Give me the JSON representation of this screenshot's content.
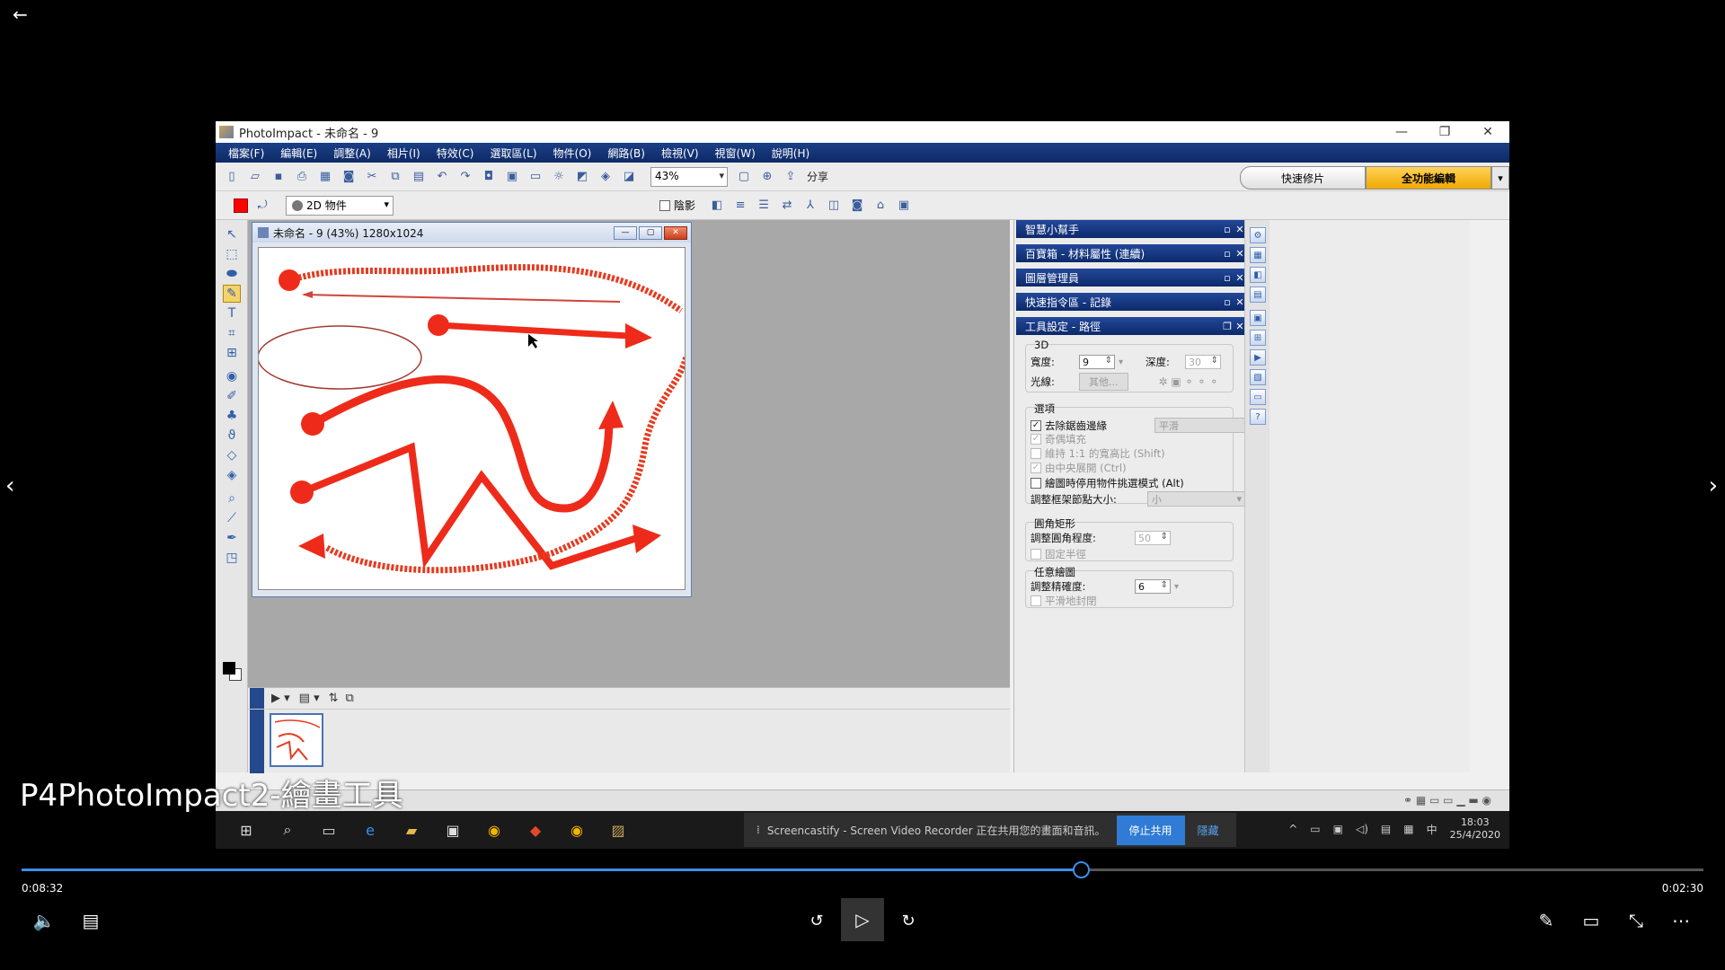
{
  "app": {
    "title": "PhotoImpact - 未命名 - 9",
    "menu": [
      "檔案(F)",
      "編輯(E)",
      "調整(A)",
      "相片(I)",
      "特效(C)",
      "選取區(L)",
      "物件(O)",
      "網路(B)",
      "檢視(V)",
      "視窗(W)",
      "說明(H)"
    ],
    "zoom": "43%",
    "share_label": "分享",
    "mode_quick": "快速修片",
    "mode_full": "全功能編輯",
    "object_type": "2D 物件",
    "shadow_label": "陰影",
    "doc_title": "未命名 - 9 (43%) 1280x1024",
    "panels": [
      "智慧小幫手",
      "百寶箱 - 材料屬性 (連續)",
      "圖層管理員",
      "快速指令區 - 記錄",
      "工具設定 - 路徑"
    ],
    "tool_settings": {
      "group_3d": "3D",
      "width_label": "寬度:",
      "width_value": "9",
      "depth_label": "深度:",
      "depth_value": "30",
      "light_label": "光線:",
      "other_label": "其他...",
      "group_options": "選項",
      "antialias_label": "去除鋸齒邊緣",
      "antialias_mode": "平滑",
      "odd_fill_label": "奇偶填充",
      "keep_ratio_label": "維持 1:1 的寬高比 (Shift)",
      "center_expand_label": "由中央展開 (Ctrl)",
      "disable_select_label": "繪圖時停用物件挑選模式 (Alt)",
      "node_size_label": "調整框架節點大小:",
      "node_size_value": "小",
      "group_round": "圓角矩形",
      "roundness_label": "調整圓角程度:",
      "roundness_value": "50",
      "fixed_radius_label": "固定半徑",
      "group_freehand": "任意繪圖",
      "precision_label": "調整精確度:",
      "precision_value": "6",
      "smooth_close_label": "平滑地封閉"
    }
  },
  "taskbar": {
    "notification": "Screencastify - Screen Video Recorder 正在共用您的畫面和音訊。",
    "stop_share": "停止共用",
    "hide": "隱藏",
    "ime": "中",
    "time": "18:03",
    "date": "25/4/2020"
  },
  "player": {
    "caption": "P4PhotoImpact2-繪畫工具",
    "current_time": "0:08:32",
    "total_time": "0:02:30",
    "progress": 0.63
  }
}
